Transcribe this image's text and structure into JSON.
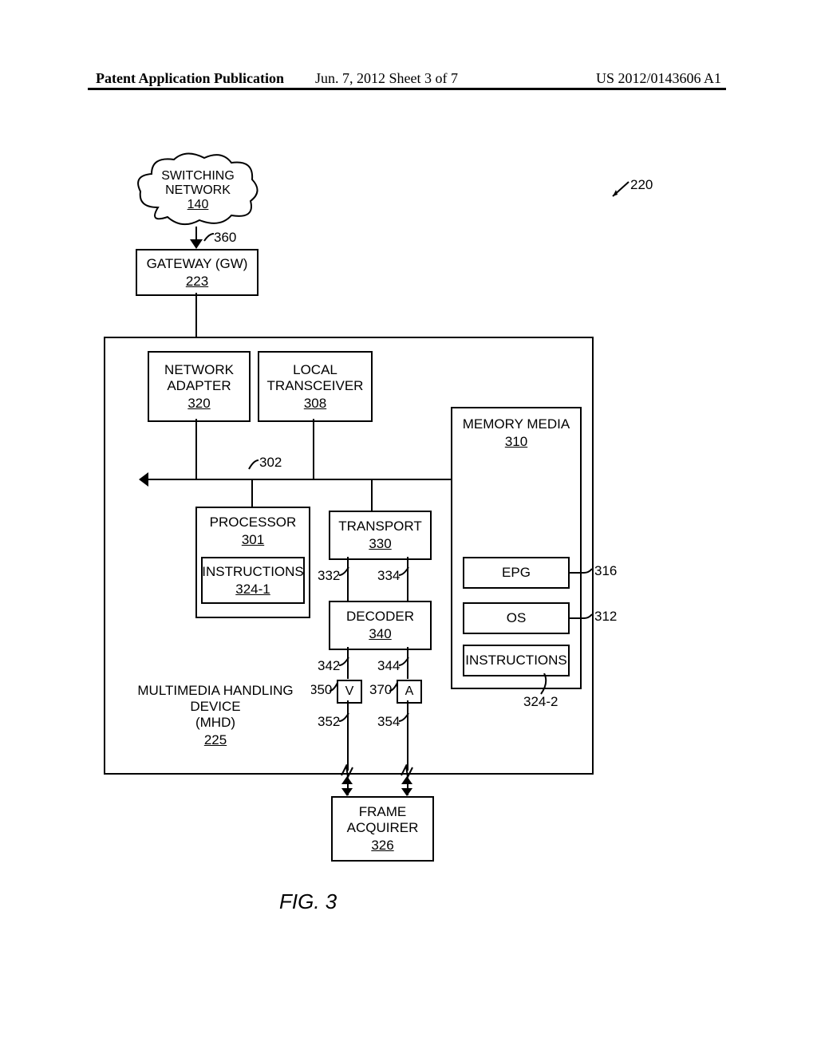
{
  "header": {
    "left": "Patent Application Publication",
    "mid": "Jun. 7, 2012  Sheet 3 of 7",
    "right": "US 2012/0143606 A1"
  },
  "figure_ref": "220",
  "cloud": {
    "title": "SWITCHING\nNETWORK",
    "ref": "140"
  },
  "arrow_360": "360",
  "gateway": {
    "title": "GATEWAY (GW)",
    "ref": "223"
  },
  "network_adapter": {
    "title": "NETWORK\nADAPTER",
    "ref": "320"
  },
  "local_transceiver": {
    "title": "LOCAL\nTRANSCEIVER",
    "ref": "308"
  },
  "bus_ref": "302",
  "processor": {
    "title": "PROCESSOR",
    "ref": "301"
  },
  "instructions1": {
    "title": "INSTRUCTIONS",
    "ref": "324-1"
  },
  "transport": {
    "title": "TRANSPORT",
    "ref": "330"
  },
  "t332": "332",
  "t334": "334",
  "decoder": {
    "title": "DECODER",
    "ref": "340"
  },
  "d342": "342",
  "d344": "344",
  "v350": "350",
  "a370": "370",
  "v_label": "V",
  "a_label": "A",
  "l352": "352",
  "l354": "354",
  "memory_media": {
    "title": "MEMORY MEDIA",
    "ref": "310"
  },
  "epg": {
    "title": "EPG",
    "ref": "316"
  },
  "os": {
    "title": "OS",
    "ref": "312"
  },
  "instructions2": {
    "title": "INSTRUCTIONS",
    "ref": "324-2"
  },
  "mhd": {
    "title_line1": "MULTIMEDIA HANDLING DEVICE",
    "title_line2": "(MHD)",
    "ref": "225"
  },
  "frame_acquirer": {
    "title": "FRAME\nACQUIRER",
    "ref": "326"
  },
  "fig_label": "FIG. 3"
}
